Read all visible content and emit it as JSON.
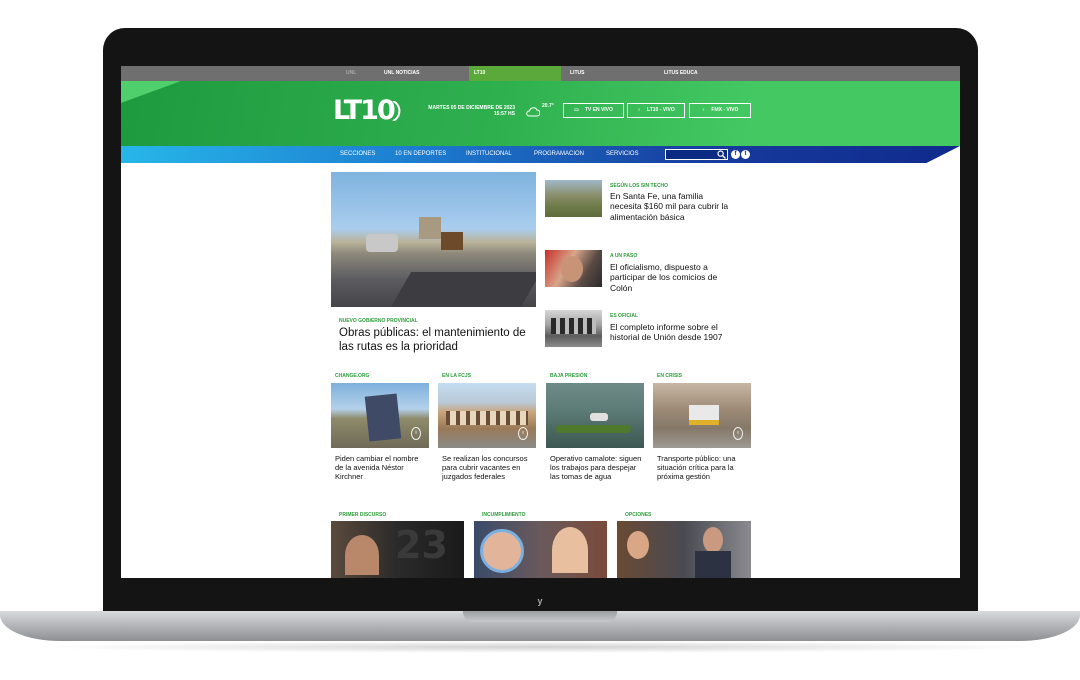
{
  "topbar": {
    "tabs": [
      "UNL",
      "UNL NOTICIAS",
      "LT10",
      "LITUS",
      "LITUS EDUCA"
    ]
  },
  "header": {
    "logo": "LT10",
    "date": "MARTES 05 DE DICIEMBRE DE 2023",
    "time": "15:57 HS",
    "temperature": "20.7°",
    "live_buttons": [
      "TV EN VIVO",
      "LT10 - VIVO",
      "FMX - VIVO"
    ]
  },
  "nav": {
    "items": [
      "SECCIONES",
      "10 EN DEPORTES",
      "INSTITUCIONAL",
      "PROGRAMACION",
      "SERVICIOS"
    ],
    "search_placeholder": ""
  },
  "main_story": {
    "kicker": "NUEVO GOBIERNO PROVINCIAL",
    "title": "Obras públicas: el mantenimiento de las rutas es la prioridad"
  },
  "side_stories": [
    {
      "kicker": "SEGÚN LOS SIN TECHO",
      "title": "En Santa Fe, una familia necesita $160 mil para cubrir la alimentación básica"
    },
    {
      "kicker": "A UN PASO",
      "title": "El oficialismo, dispuesto a participar de los comicios de Colón"
    },
    {
      "kicker": "ES OFICIAL",
      "title": "El completo informe sobre el historial de Unión desde 1907"
    }
  ],
  "grid_stories": [
    {
      "kicker": "CHANGE.ORG",
      "title": "Piden cambiar el nombre de la avenida Néstor Kirchner"
    },
    {
      "kicker": "EN LA FCJS",
      "title": "Se realizan los concursos para cubrir vacantes en juzgados federales"
    },
    {
      "kicker": "BAJA PRESIÓN",
      "title": "Operativo camalote: siguen los trabajos para despejar las tomas de agua"
    },
    {
      "kicker": "EN CRISIS",
      "title": "Transporte público: una situación crítica para la próxima gestión"
    }
  ],
  "bottom_stories": [
    {
      "kicker": "PRIMER DISCURSO"
    },
    {
      "kicker": "INCUMPLIMIENTO"
    },
    {
      "kicker": "OPCIONES"
    }
  ],
  "colors": {
    "header_green": "#43c862",
    "active_tab": "#5ca93b",
    "nav_blue": "#173b9e",
    "kicker_green": "#2e9e3c"
  }
}
